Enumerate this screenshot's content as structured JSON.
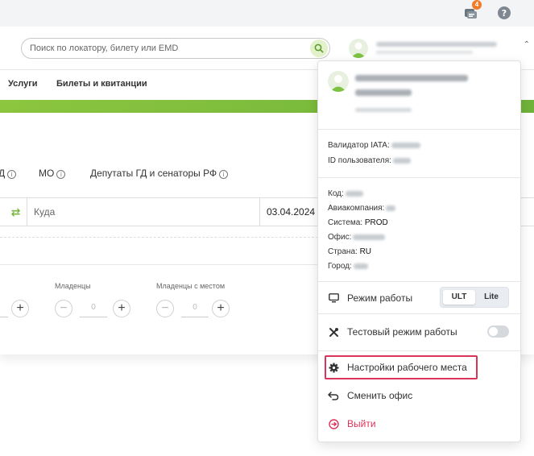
{
  "topbar": {
    "chat_badge": "4",
    "icons": [
      "chat-icon",
      "help-icon"
    ]
  },
  "header": {
    "search_placeholder": "Поиск по локатору, билету или EMD"
  },
  "nav": {
    "items": [
      "Услуги",
      "Билеты и квитанции"
    ]
  },
  "form": {
    "filters": [
      "Д",
      "МО",
      "Депутаты ГД и сенаторы РФ"
    ],
    "to_label": "Куда",
    "date": "03.04.2024",
    "passengers": [
      {
        "label": "",
        "value": ""
      },
      {
        "label": "Младенцы",
        "value": "0"
      },
      {
        "label": "Младенцы с местом",
        "value": "0"
      }
    ]
  },
  "panel": {
    "info1": {
      "validator_label": "Валидатор IATA:",
      "user_id_label": "ID пользователя:"
    },
    "info2": {
      "code_label": "Код:",
      "airline_label": "Авиакомпания:",
      "system_label": "Система:",
      "system_value": "PROD",
      "office_label": "Офис:",
      "country_label": "Страна:",
      "country_value": "RU",
      "city_label": "Город:"
    },
    "work_mode": {
      "label": "Режим работы",
      "options": [
        "ULT",
        "Lite"
      ],
      "selected": "ULT"
    },
    "test_mode": {
      "label": "Тестовый режим работы",
      "enabled": false
    },
    "settings_label": "Настройки рабочего места",
    "change_office_label": "Сменить офис",
    "logout_label": "Выйти",
    "colors": {
      "accent": "#8cc63f",
      "danger": "#d9345a"
    }
  }
}
